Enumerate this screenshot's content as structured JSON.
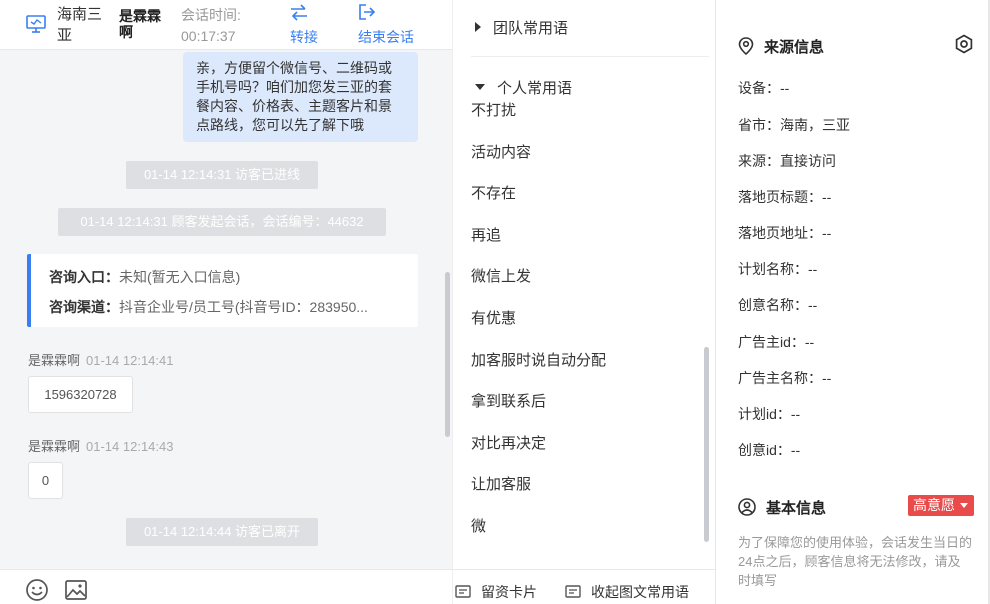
{
  "header": {
    "location": "海南三亚",
    "visitor_name": "是霖霖啊",
    "time_label": "会话时间:",
    "time_value": "00:17:37",
    "transfer_label": "转接",
    "end_label": "结束会话"
  },
  "chat": {
    "agent_bubble": "亲，方便留个微信号、二维码或手机号吗？咱们加您发三亚的套餐内容、价格表、主题客片和景点路线，您可以先了解下哦",
    "system_notes": [
      "01-14 12:14:31 访客已进线",
      "01-14 12:14:31 顾客发起会话，会话编号：44632",
      "01-14 12:14:44 访客已离开"
    ],
    "entry_card": {
      "entry_label": "咨询入口：",
      "entry_value": "未知(暂无入口信息)",
      "channel_label": "咨询渠道：",
      "channel_value": "抖音企业号/员工号(抖音号ID：283950..."
    },
    "messages": [
      {
        "sender": "是霖霖啊",
        "time": "01-14 12:14:41",
        "text": "1596320728"
      },
      {
        "sender": "是霖霖啊",
        "time": "01-14 12:14:43",
        "text": "0"
      }
    ],
    "footer_icons": [
      "emoji-icon",
      "image-icon"
    ]
  },
  "phrases": {
    "team_group": "团队常用语",
    "personal_group": "个人常用语",
    "items": [
      "不打扰",
      "活动内容",
      "不存在",
      "再追",
      "微信上发",
      "有优惠",
      "加客服时说自动分配",
      "拿到联系后",
      "对比再决定",
      "让加客服",
      "微"
    ],
    "footer": {
      "card_label": "留资卡片",
      "collect_label": "收起图文常用语"
    }
  },
  "info": {
    "source_title": "来源信息",
    "source_fields": [
      "设备：--",
      "省市：海南，三亚",
      "来源：直接访问",
      "落地页标题：--",
      "落地页地址：--",
      "计划名称：--",
      "创意名称：--",
      "广告主id：--",
      "广告主名称：--",
      "计划id：--",
      "创意id：--"
    ],
    "basic_title": "基本信息",
    "intent_badge": "高意愿",
    "notice": "为了保障您的使用体验，会话发生当日的24点之后，顾客信息将无法修改，请及时填写"
  },
  "colors": {
    "accent": "#3a7ff2",
    "badge": "#e94b4b",
    "bubble": "#dce8fb"
  }
}
